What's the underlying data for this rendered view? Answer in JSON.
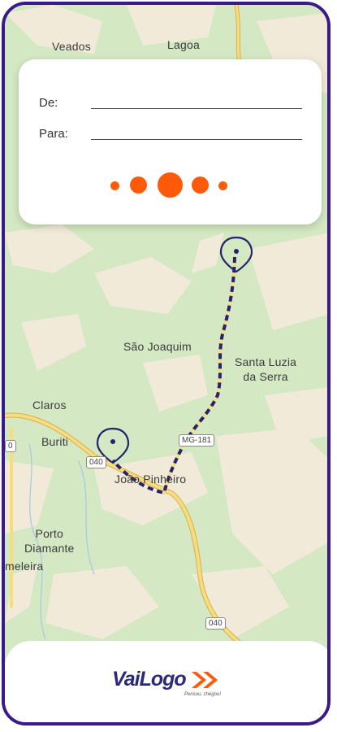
{
  "search": {
    "from_label": "De:",
    "to_label": "Para:"
  },
  "map": {
    "places": {
      "veados": "Veados",
      "lagoa": "Lagoa",
      "sao_joaquim": "São Joaquim",
      "santa_luzia": "Santa Luzia\nda Serra",
      "claros": "Claros",
      "buriti": "Buriti",
      "joao_pinheiro": "João Pinheiro",
      "porto_diamante": "Porto\nDiamante",
      "meleira": "meleira"
    },
    "shields": {
      "mg181": "MG-181",
      "br040_a": "040",
      "br040_b": "040",
      "edge": "0"
    },
    "route": {
      "start": "João Pinheiro",
      "end": "north marker"
    }
  },
  "brand": {
    "name": "VaiLogo",
    "tagline": "Pensou, chegou!",
    "colors": {
      "primary": "#2a2a7a",
      "accent": "#ff5a0a",
      "frame": "#3a1a8a"
    }
  },
  "icons": {
    "pin": "map-pin-icon",
    "logo_arrows": "double-chevron-icon"
  }
}
